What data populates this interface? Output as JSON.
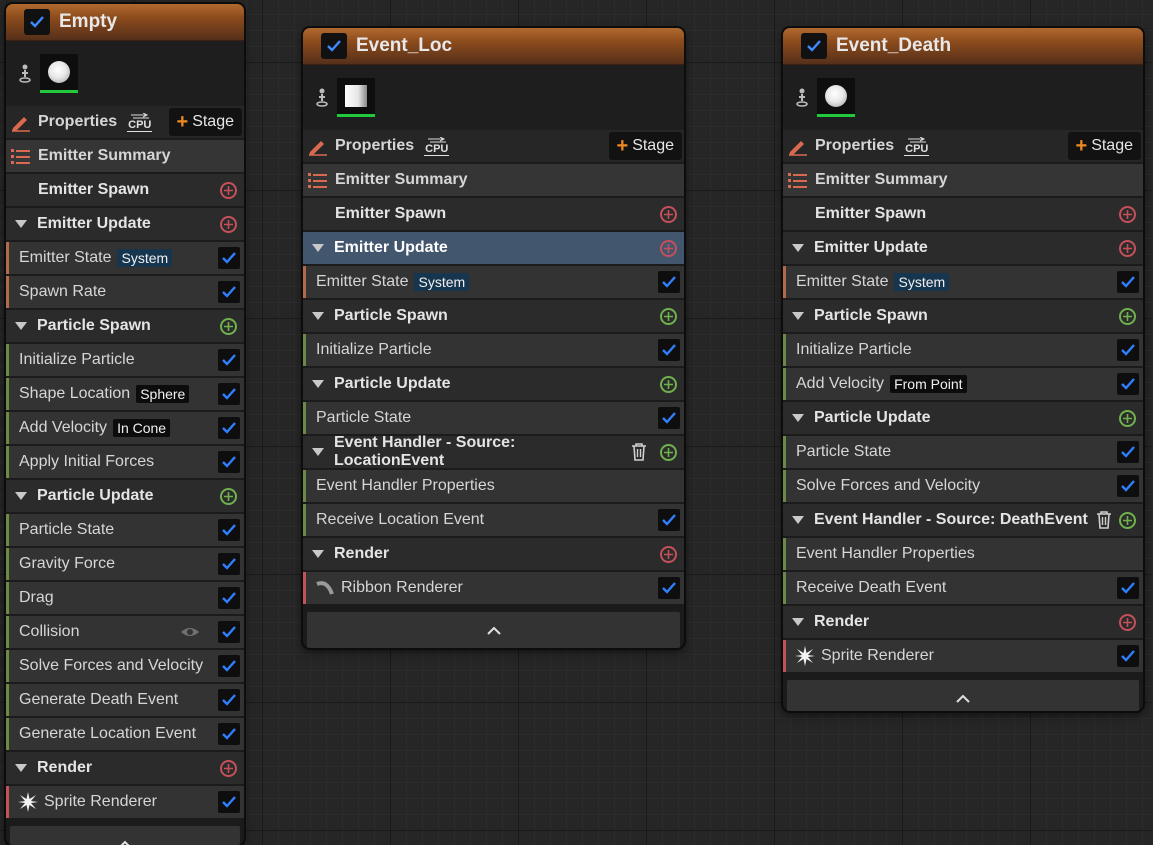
{
  "colors": {
    "spawn_rate_stripe": "#b36a4a",
    "particle_stripe": "#6b8a45",
    "render_stripe": "#c4505a",
    "event_stripe": "#6b8a45",
    "checkbox_accent": "#2f7fff",
    "add_red": "#c4505a",
    "add_green": "#6fb14d",
    "stage_plus": "#f08a24",
    "thumb_active": "#22c93a"
  },
  "icons": {
    "properties": "pencil-icon",
    "cpu": "cpu-sim-target-icon",
    "summary": "list-icon",
    "stage_add": "plus-icon",
    "section_add": "add-circle-icon",
    "collapse": "chevron-up-icon",
    "event_delete": "trash-icon",
    "visibility": "eye-icon",
    "sprite": "sprite-starburst-icon",
    "ribbon": "ribbon-curve-icon"
  },
  "toolbar": {
    "properties_label": "Properties",
    "cpu_label": "CPU",
    "stage_label": "Stage",
    "summary_label": "Emitter Summary"
  },
  "emitters": [
    {
      "title": "Empty",
      "emitter_spawn": "Emitter Spawn",
      "emitter_update": "Emitter Update",
      "emitter_state": "Emitter State",
      "emitter_state_badge": "System",
      "spawn_rate": "Spawn Rate",
      "particle_spawn": "Particle Spawn",
      "initialize_particle": "Initialize Particle",
      "shape_location": "Shape Location",
      "shape_location_badge": "Sphere",
      "add_velocity": "Add Velocity",
      "add_velocity_badge": "In Cone",
      "apply_initial_forces": "Apply Initial Forces",
      "particle_update": "Particle Update",
      "particle_state": "Particle State",
      "gravity_force": "Gravity Force",
      "drag": "Drag",
      "collision": "Collision",
      "solve_forces": "Solve Forces and Velocity",
      "gen_death_event": "Generate Death Event",
      "gen_location_event": "Generate Location Event",
      "render": "Render",
      "renderer": "Sprite Renderer"
    },
    {
      "title": "Event_Loc",
      "emitter_spawn": "Emitter Spawn",
      "emitter_update": "Emitter Update",
      "emitter_state": "Emitter State",
      "emitter_state_badge": "System",
      "particle_spawn": "Particle Spawn",
      "initialize_particle": "Initialize Particle",
      "particle_update": "Particle Update",
      "particle_state": "Particle State",
      "event_handler": "Event Handler - Source: LocationEvent",
      "event_handler_props": "Event Handler Properties",
      "receive_event": "Receive Location Event",
      "render": "Render",
      "renderer": "Ribbon Renderer"
    },
    {
      "title": "Event_Death",
      "emitter_spawn": "Emitter Spawn",
      "emitter_update": "Emitter Update",
      "emitter_state": "Emitter State",
      "emitter_state_badge": "System",
      "particle_spawn": "Particle Spawn",
      "initialize_particle": "Initialize Particle",
      "add_velocity": "Add Velocity",
      "add_velocity_badge": "From Point",
      "particle_update": "Particle Update",
      "particle_state": "Particle State",
      "solve_forces": "Solve Forces and Velocity",
      "event_handler": "Event Handler - Source: DeathEvent",
      "event_handler_props": "Event Handler Properties",
      "receive_event": "Receive Death Event",
      "render": "Render",
      "renderer": "Sprite Renderer"
    }
  ]
}
